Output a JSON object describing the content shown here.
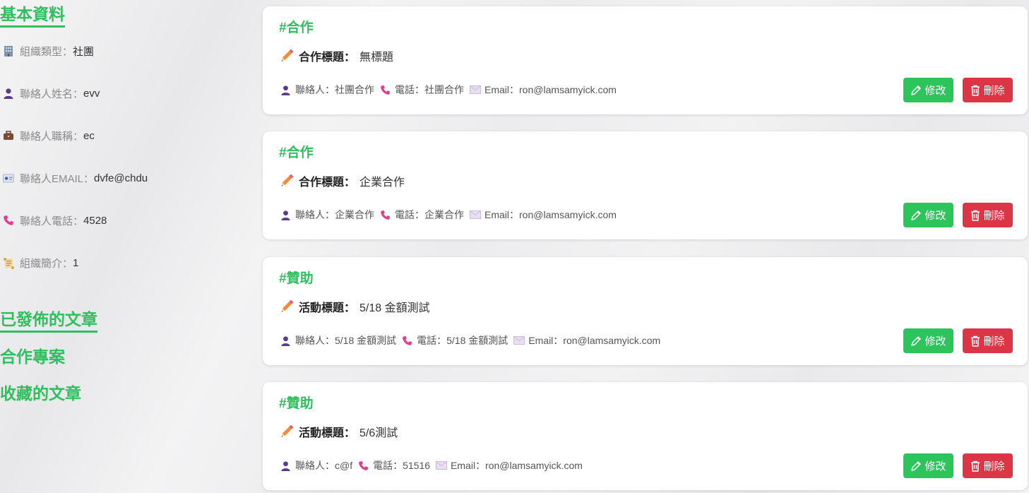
{
  "sidebar": {
    "profile_heading": "基本資料",
    "info": [
      {
        "icon": "office-building-icon",
        "label": "組織類型",
        "sep": "：",
        "value": "社團"
      },
      {
        "icon": "person-icon",
        "label": "聯絡人姓名",
        "sep": "：",
        "value": "evv"
      },
      {
        "icon": "briefcase-icon",
        "label": "聯絡人職稱",
        "sep": "：",
        "value": "ec"
      },
      {
        "icon": "id-card-icon",
        "label": "聯絡人EMAIL",
        "sep": "：",
        "value": "dvfe@chdu"
      },
      {
        "icon": "phone-icon",
        "label": "聯絡人電話",
        "sep": "：",
        "value": "4528"
      },
      {
        "icon": "scroll-icon",
        "label": "組織簡介",
        "sep": "：",
        "value": "1"
      }
    ],
    "nav": {
      "published": "已發佈的文章",
      "projects": "合作專案",
      "favorites": "收藏的文章"
    }
  },
  "cards": [
    {
      "tag": "#合作",
      "title_label": "合作標題：",
      "title_value": "無標題",
      "contact": "聯絡人：社團合作",
      "phone": "電話：社團合作",
      "email": "Email：ron@lamsamyick.com",
      "edit_label": "修改",
      "delete_label": "刪除"
    },
    {
      "tag": "#合作",
      "title_label": "合作標題：",
      "title_value": "企業合作",
      "contact": "聯絡人：企業合作",
      "phone": "電話：企業合作",
      "email": "Email：ron@lamsamyick.com",
      "edit_label": "修改",
      "delete_label": "刪除"
    },
    {
      "tag": "#贊助",
      "title_label": "活動標題：",
      "title_value": "5/18 金額測試",
      "contact": "聯絡人：5/18 金額測試",
      "phone": "電話：5/18 金額測試",
      "email": "Email：ron@lamsamyick.com",
      "edit_label": "修改",
      "delete_label": "刪除"
    },
    {
      "tag": "#贊助",
      "title_label": "活動標題：",
      "title_value": "5/6測試",
      "contact": "聯絡人：c@f",
      "phone": "電話：51516",
      "email": "Email：ron@lamsamyick.com",
      "edit_label": "修改",
      "delete_label": "刪除"
    }
  ],
  "colors": {
    "accent_green": "#2fbf5e",
    "edit_button": "#2dc45c",
    "delete_button": "#dc3545"
  }
}
